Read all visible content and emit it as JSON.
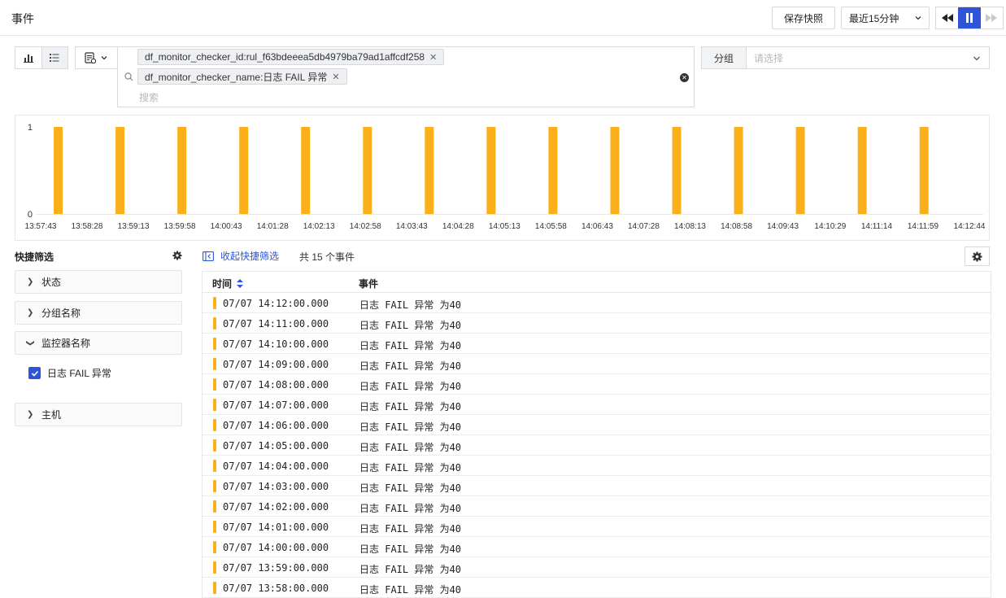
{
  "header": {
    "title": "事件",
    "save_label": "保存快照",
    "time_range": "最近15分钟"
  },
  "search": {
    "tags": [
      "df_monitor_checker_id:rul_f63bdeeea5db4979ba79ad1affcdf258",
      "df_monitor_checker_name:日志 FAIL 异常"
    ],
    "placeholder": "搜索"
  },
  "group": {
    "label": "分组",
    "placeholder": "请选择"
  },
  "colors": {
    "accent": "#2f54d8",
    "bar": "#fbb019"
  },
  "chart_data": {
    "type": "bar",
    "x_ticks": [
      "13:57:43",
      "13:58:28",
      "13:59:13",
      "13:59:58",
      "14:00:43",
      "14:01:28",
      "14:02:13",
      "14:02:58",
      "14:03:43",
      "14:04:28",
      "14:05:13",
      "14:05:58",
      "14:06:43",
      "14:07:28",
      "14:08:13",
      "14:08:58",
      "14:09:43",
      "14:10:29",
      "14:11:14",
      "14:11:59",
      "14:12:44"
    ],
    "y_ticks": [
      "1",
      "0"
    ],
    "ylim": [
      0,
      1
    ],
    "series": [
      {
        "values": [
          {
            "t": "13:58:00",
            "v": 1
          },
          {
            "t": "13:59:00",
            "v": 1
          },
          {
            "t": "14:00:00",
            "v": 1
          },
          {
            "t": "14:01:00",
            "v": 1
          },
          {
            "t": "14:02:00",
            "v": 1
          },
          {
            "t": "14:03:00",
            "v": 1
          },
          {
            "t": "14:04:00",
            "v": 1
          },
          {
            "t": "14:05:00",
            "v": 1
          },
          {
            "t": "14:06:00",
            "v": 1
          },
          {
            "t": "14:07:00",
            "v": 1
          },
          {
            "t": "14:08:00",
            "v": 1
          },
          {
            "t": "14:09:00",
            "v": 1
          },
          {
            "t": "14:10:00",
            "v": 1
          },
          {
            "t": "14:11:00",
            "v": 1
          },
          {
            "t": "14:12:00",
            "v": 1
          }
        ]
      }
    ]
  },
  "quick_filter": {
    "title": "快捷筛选",
    "items": [
      "状态",
      "分组名称",
      "监控器名称",
      "主机"
    ],
    "checked_option": "日志 FAIL 异常"
  },
  "table": {
    "collapse_label": "收起快捷筛选",
    "count_label": "共 15 个事件",
    "col_time": "时间",
    "col_event": "事件",
    "rows": [
      {
        "time": "07/07 14:12:00.000",
        "event": "日志 FAIL 异常 为40"
      },
      {
        "time": "07/07 14:11:00.000",
        "event": "日志 FAIL 异常 为40"
      },
      {
        "time": "07/07 14:10:00.000",
        "event": "日志 FAIL 异常 为40"
      },
      {
        "time": "07/07 14:09:00.000",
        "event": "日志 FAIL 异常 为40"
      },
      {
        "time": "07/07 14:08:00.000",
        "event": "日志 FAIL 异常 为40"
      },
      {
        "time": "07/07 14:07:00.000",
        "event": "日志 FAIL 异常 为40"
      },
      {
        "time": "07/07 14:06:00.000",
        "event": "日志 FAIL 异常 为40"
      },
      {
        "time": "07/07 14:05:00.000",
        "event": "日志 FAIL 异常 为40"
      },
      {
        "time": "07/07 14:04:00.000",
        "event": "日志 FAIL 异常 为40"
      },
      {
        "time": "07/07 14:03:00.000",
        "event": "日志 FAIL 异常 为40"
      },
      {
        "time": "07/07 14:02:00.000",
        "event": "日志 FAIL 异常 为40"
      },
      {
        "time": "07/07 14:01:00.000",
        "event": "日志 FAIL 异常 为40"
      },
      {
        "time": "07/07 14:00:00.000",
        "event": "日志 FAIL 异常 为40"
      },
      {
        "time": "07/07 13:59:00.000",
        "event": "日志 FAIL 异常 为40"
      },
      {
        "time": "07/07 13:58:00.000",
        "event": "日志 FAIL 异常 为40"
      }
    ]
  }
}
